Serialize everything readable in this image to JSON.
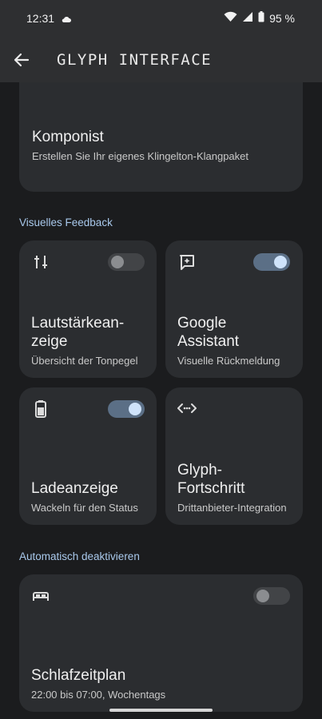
{
  "status": {
    "time": "12:31",
    "battery": "95 %"
  },
  "appbar": {
    "title": "GLYPH INTERFACE"
  },
  "komponist": {
    "title": "Komponist",
    "subtitle": "Erstellen Sie Ihr eigenes Klingelton-Klangpaket"
  },
  "sections": {
    "visual_feedback": "Visuelles Feedback",
    "auto_disable": "Automatisch deaktivieren"
  },
  "tiles": {
    "volume": {
      "title": "Lautstärkean-\nzeige",
      "title_line1": "Lautstärkean-",
      "title_line2": "zeige",
      "subtitle": "Übersicht der Tonpegel",
      "enabled": false
    },
    "assistant": {
      "title_line1": "Google",
      "title_line2": "Assistant",
      "subtitle": "Visuelle Rückmeldung",
      "enabled": true
    },
    "charging": {
      "title_line1": "Ladeanzeige",
      "subtitle": "Wackeln für den Status",
      "enabled": true
    },
    "progress": {
      "title_line1": "Glyph-",
      "title_line2": "Fortschritt",
      "subtitle": "Drittanbieter-Integration"
    }
  },
  "sleep": {
    "title": "Schlafzeitplan",
    "subtitle": "22:00 bis 07:00, Wochentags",
    "enabled": false
  },
  "colors": {
    "accent": "#a9c9ec",
    "toggle_on": "#5b6f86",
    "card": "#2b2d30"
  }
}
